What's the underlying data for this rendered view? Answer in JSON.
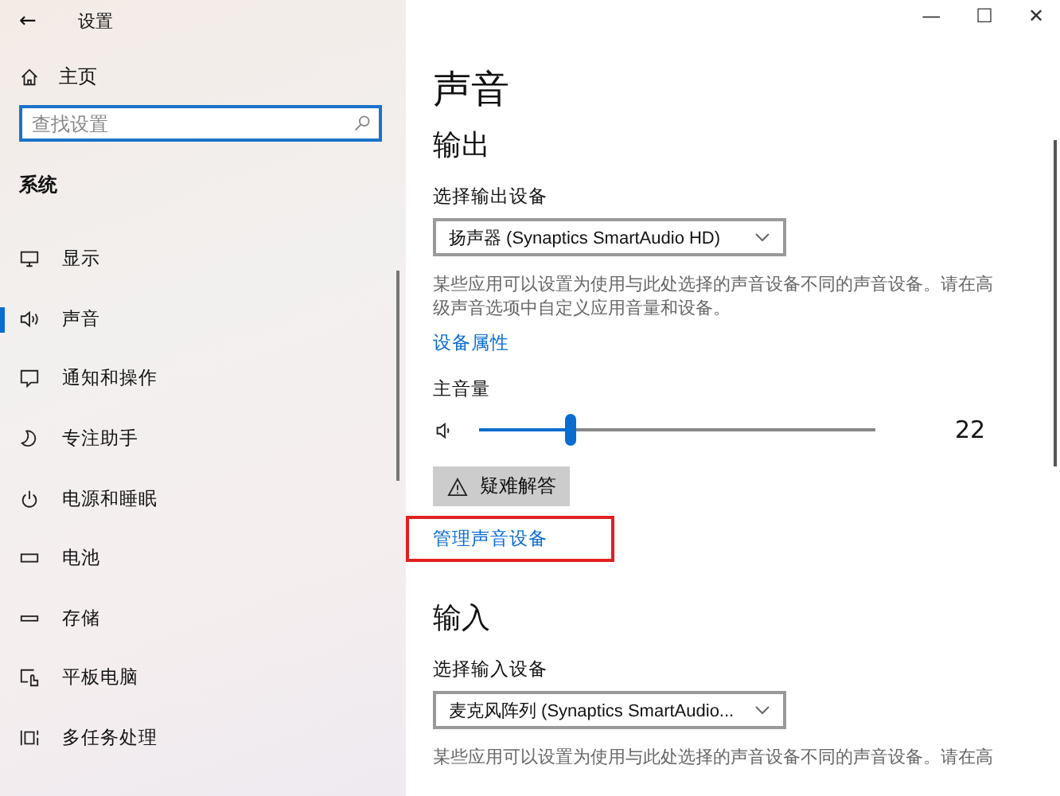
{
  "window": {
    "back": "←",
    "title": "设置",
    "controls": [
      "—",
      "☐",
      "✕"
    ]
  },
  "sidebar": {
    "home": "主页",
    "search": {
      "placeholder": "查找设置"
    },
    "section": "系统",
    "items": [
      {
        "label": "显示",
        "kind": "monitor",
        "selected": false
      },
      {
        "label": "声音",
        "kind": "speaker",
        "selected": true
      },
      {
        "label": "通知和操作",
        "kind": "message",
        "selected": false
      },
      {
        "label": "专注助手",
        "kind": "moon",
        "selected": false
      },
      {
        "label": "电源和睡眠",
        "kind": "power",
        "selected": false
      },
      {
        "label": "电池",
        "kind": "battery",
        "selected": false
      },
      {
        "label": "存储",
        "kind": "drive",
        "selected": false
      },
      {
        "label": "平板电脑",
        "kind": "tablet",
        "selected": false
      },
      {
        "label": "多任务处理",
        "kind": "multitask",
        "selected": false
      }
    ]
  },
  "page": {
    "title": "声音",
    "output": {
      "heading": "输出",
      "device_label": "选择输出设备",
      "device": "扬声器 (Synaptics SmartAudio HD)",
      "description": "某些应用可以设置为使用与此处选择的声音设备不同的声音设备。请在高级声音选项中自定义应用音量和设备。",
      "properties_link": "设备属性",
      "volume_label": "主音量",
      "volume": {
        "level": 0.22,
        "reading": "22"
      },
      "troubleshoot_button": "疑难解答",
      "manage_link": "管理声音设备"
    },
    "input": {
      "heading": "输入",
      "device_label": "选择输入设备",
      "device": "麦克风阵列 (Synaptics SmartAudio...",
      "description": "某些应用可以设置为使用与此处选择的声音设备不同的声音设备。请在高"
    }
  }
}
